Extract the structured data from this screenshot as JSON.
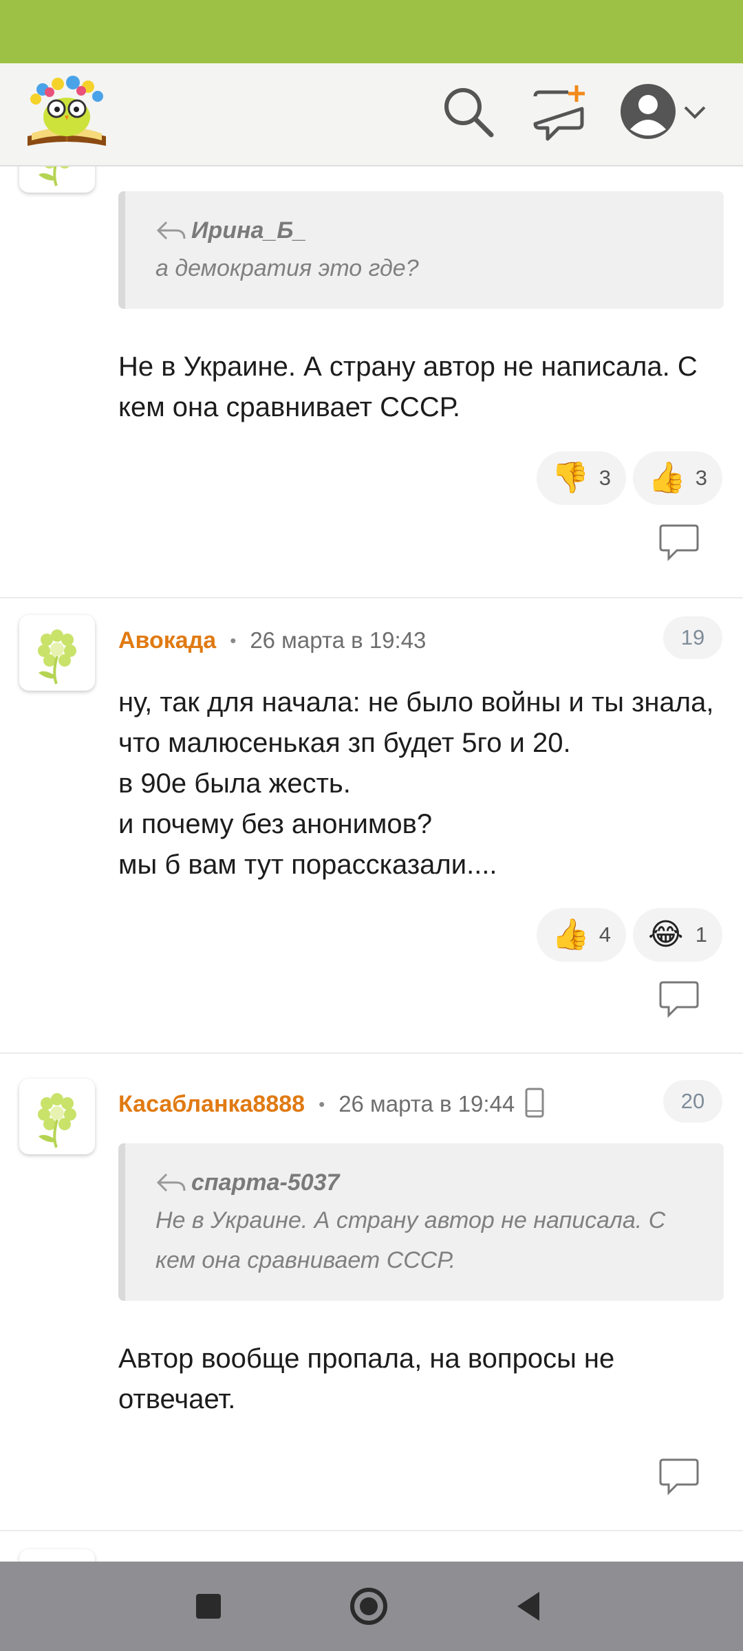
{
  "header": {
    "logo_icon": "owl-on-book-logo",
    "search_icon": "search-icon",
    "new_topic_icon": "new-topic-icon",
    "profile_icon": "profile-avatar-icon",
    "menu_icon": "chevron-down-icon",
    "status_bar_color": "#9dc145",
    "accent_color": "#f28a1a"
  },
  "comments": [
    {
      "quote_author": "Ирина_Б_",
      "quote_text": "а демократия это где?",
      "text": "Не в Украине. А страну автор не написала. С кем она сравнивает СССР.",
      "reactions": [
        {
          "emoji": "👎",
          "icon": "thumbs-down-icon",
          "count": "3"
        },
        {
          "emoji": "👍",
          "icon": "thumbs-up-icon",
          "count": "3"
        }
      ]
    },
    {
      "author": "Авокада",
      "time": "26 марта в 19:43",
      "number": "19",
      "text": "ну, так для начала: не было войны и ты знала, что малюсенькая зп будет 5го и 20.\nв 90е была жесть.\nи почему без анонимов?\nмы б вам тут порассказали....",
      "reactions": [
        {
          "emoji": "👍",
          "icon": "thumbs-up-icon",
          "count": "4"
        },
        {
          "emoji": "😂",
          "icon": "laughing-icon",
          "count": "1"
        }
      ]
    },
    {
      "author": "Касабланка8888",
      "time": "26 марта в 19:44",
      "number": "20",
      "device_icon": "mobile-phone-icon",
      "quote_author": "спарта-5037",
      "quote_text": "Не в Украине. А страну автор не написала. С кем она сравнивает СССР.",
      "text": "Автор вообще пропала, на вопросы не отвечает."
    }
  ],
  "navigation": {
    "recent_icon": "square-icon",
    "home_icon": "circle-icon",
    "back_icon": "triangle-back-icon"
  }
}
